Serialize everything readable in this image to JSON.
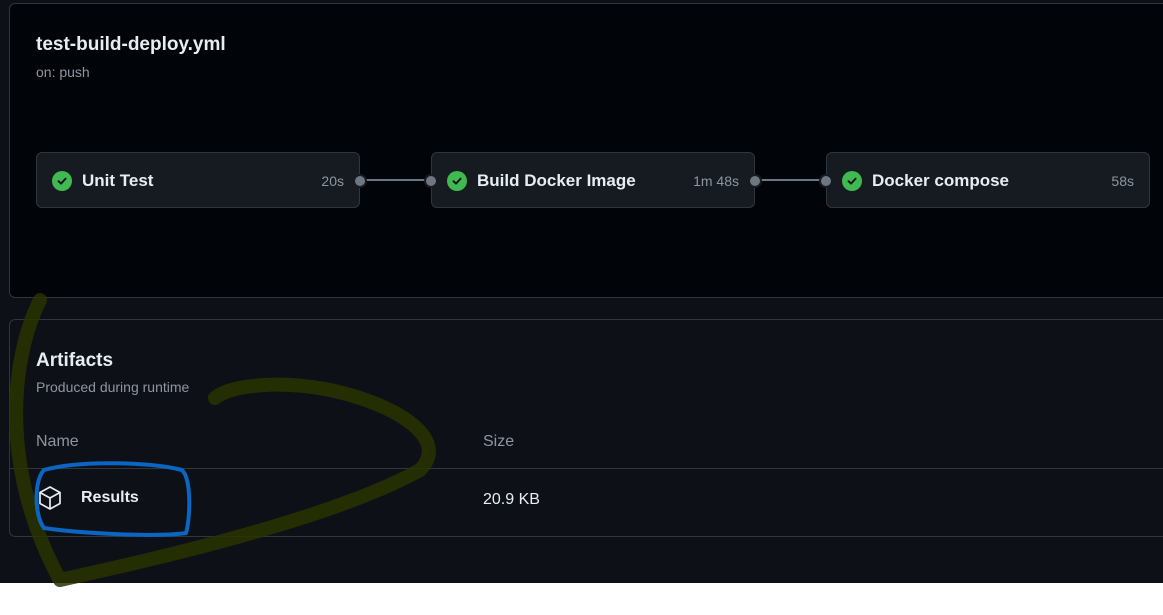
{
  "workflow": {
    "title": "test-build-deploy.yml",
    "trigger": "on: push",
    "jobs": [
      {
        "name": "Unit Test",
        "duration": "20s",
        "status": "success"
      },
      {
        "name": "Build Docker Image",
        "duration": "1m 48s",
        "status": "success"
      },
      {
        "name": "Docker compose",
        "duration": "58s",
        "status": "success"
      }
    ]
  },
  "artifacts": {
    "title": "Artifacts",
    "subtitle": "Produced during runtime",
    "columns": {
      "name": "Name",
      "size": "Size"
    },
    "rows": [
      {
        "name": "Results",
        "size": "20.9 KB",
        "icon": "package-icon"
      }
    ]
  },
  "colors": {
    "success": "#3fb950",
    "annotation_highlight": "#0a66c2",
    "annotation_dark": "#2a3300"
  }
}
